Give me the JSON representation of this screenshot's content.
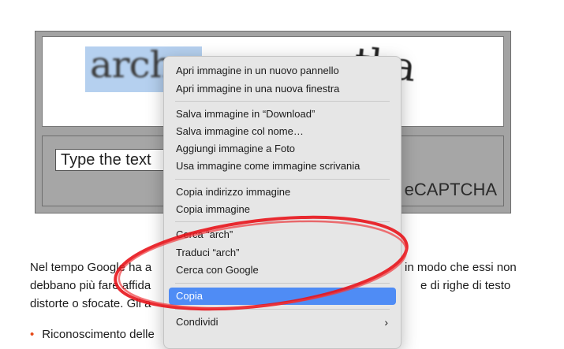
{
  "captcha": {
    "word1": "arch",
    "word2": "tka",
    "input_value": "Type the text",
    "brand": "eCAPTCHA"
  },
  "paragraph": {
    "line1": "Nel tempo Google ha a",
    "line1_right": "in modo che essi non",
    "line2": "debbano più fare affida",
    "line2_right": "e di righe di testo",
    "line3": "distorte o sfocate. Gli a"
  },
  "bullet": "Riconoscimento delle",
  "context_menu": {
    "items": [
      "Apri immagine in un nuovo pannello",
      "Apri immagine in una nuova finestra",
      "Salva immagine in “Download”",
      "Salva immagine col nome…",
      "Aggiungi immagine a Foto",
      "Usa immagine come immagine scrivania",
      "Copia indirizzo immagine",
      "Copia immagine",
      "Cerca “arch”",
      "Traduci “arch”",
      "Cerca con Google",
      "Copia",
      "Condividi"
    ],
    "highlighted": "Copia"
  },
  "colors": {
    "highlight": "#4f8cf5",
    "annotation": "#e8141b",
    "bullet": "#e64a19"
  }
}
